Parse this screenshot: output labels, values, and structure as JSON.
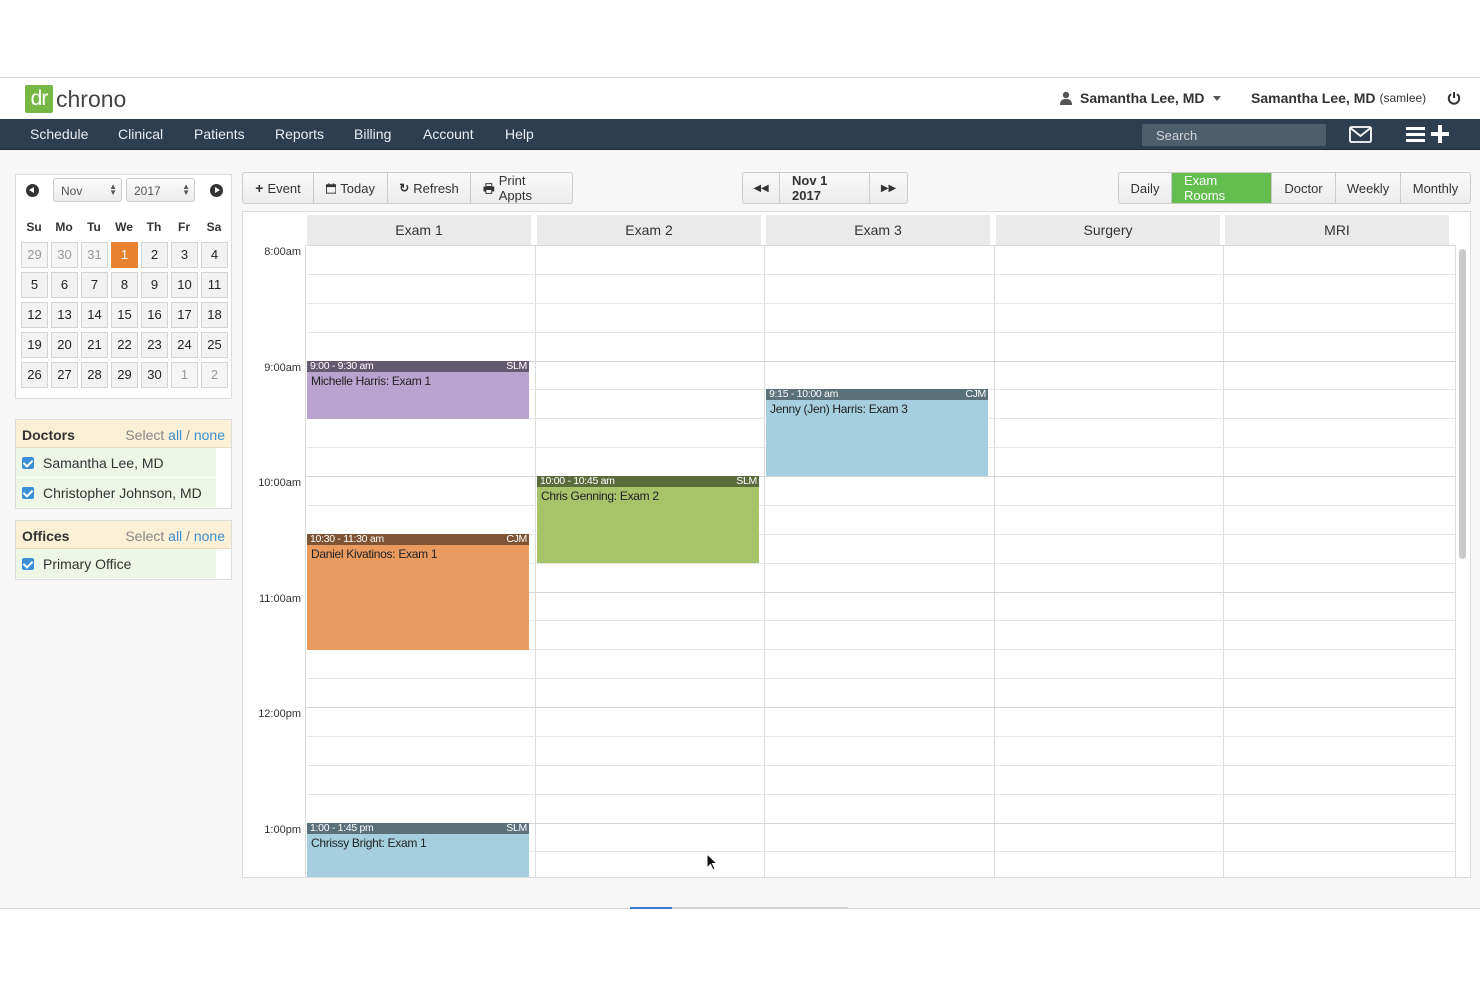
{
  "brand": {
    "logo_mark": "dr",
    "logo_text": "chrono",
    "accent": "#76b843"
  },
  "user": {
    "current_user": "Samantha Lee, MD",
    "account_name": "Samantha Lee, MD",
    "account_username": "(samlee)"
  },
  "nav": {
    "items": [
      "Schedule",
      "Clinical",
      "Patients",
      "Reports",
      "Billing",
      "Account",
      "Help"
    ],
    "search_placeholder": "Search"
  },
  "minical": {
    "month": "Nov",
    "year": "2017",
    "weekdays": [
      "Su",
      "Mo",
      "Tu",
      "We",
      "Th",
      "Fr",
      "Sa"
    ],
    "weeks": [
      [
        "29",
        "30",
        "31",
        "1",
        "2",
        "3",
        "4"
      ],
      [
        "5",
        "6",
        "7",
        "8",
        "9",
        "10",
        "11"
      ],
      [
        "12",
        "13",
        "14",
        "15",
        "16",
        "17",
        "18"
      ],
      [
        "19",
        "20",
        "21",
        "22",
        "23",
        "24",
        "25"
      ],
      [
        "26",
        "27",
        "28",
        "29",
        "30",
        "1",
        "2"
      ]
    ],
    "selected": "1"
  },
  "doctors": {
    "title": "Doctors",
    "select_label": "Select",
    "all_label": "all",
    "none_label": "none",
    "items": [
      "Samantha Lee, MD",
      "Christopher Johnson, MD"
    ]
  },
  "offices": {
    "title": "Offices",
    "select_label": "Select",
    "all_label": "all",
    "none_label": "none",
    "items": [
      "Primary Office"
    ]
  },
  "toolbar": {
    "event_label": "Event",
    "today_label": "Today",
    "refresh_label": "Refresh",
    "print_label": "Print Appts",
    "date_label": "Nov 1 2017",
    "views": [
      "Daily",
      "Exam Rooms",
      "Doctor",
      "Weekly",
      "Monthly"
    ],
    "active_view": "Exam Rooms"
  },
  "calendar": {
    "columns": [
      "Exam 1",
      "Exam 2",
      "Exam 3",
      "Surgery",
      "MRI"
    ],
    "time_labels": [
      "8:00am",
      "9:00am",
      "10:00am",
      "11:00am",
      "12:00pm",
      "1:00pm"
    ],
    "appointments": [
      {
        "column": 0,
        "start_hour": 9.0,
        "end_hour": 9.5,
        "time": "9:00 - 9:30 am",
        "initials": "SLM",
        "title": "Michelle Harris: Exam 1",
        "color": "#b9a3cf"
      },
      {
        "column": 0,
        "start_hour": 10.5,
        "end_hour": 11.5,
        "time": "10:30 - 11:30 am",
        "initials": "CJM",
        "title": "Daniel Kivatinos: Exam 1",
        "color": "#e89a5f"
      },
      {
        "column": 0,
        "start_hour": 13.0,
        "end_hour": 13.75,
        "time": "1:00 - 1:45 pm",
        "initials": "SLM",
        "title": "Chrissy Bright: Exam 1",
        "color": "#a5cede"
      },
      {
        "column": 1,
        "start_hour": 10.0,
        "end_hour": 10.75,
        "time": "10:00 - 10:45 am",
        "initials": "SLM",
        "title": "Chris Genning: Exam 2",
        "color": "#a6c46a"
      },
      {
        "column": 2,
        "start_hour": 9.25,
        "end_hour": 10.0,
        "time": "9:15 - 10:00 am",
        "initials": "CJM",
        "title": "Jenny (Jen) Harris: Exam 3",
        "color": "#a5cede"
      }
    ]
  }
}
